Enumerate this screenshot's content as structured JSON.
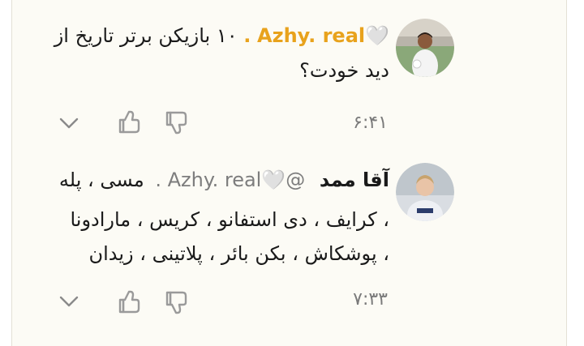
{
  "comments": [
    {
      "username": "Azhy. real",
      "heart": "🤍",
      "separator": ".",
      "text_line1": "۱۰ بازیکن برتر تاریخ از",
      "text_line2": "دید خودت؟",
      "time": "۶:۴۱",
      "icons": [
        "avatar-photo",
        "chevron-down-icon",
        "thumbs-up-icon",
        "thumbs-down-icon"
      ]
    },
    {
      "author": "آقا ممد",
      "mention_at": "@",
      "mention_user": "Azhy. real",
      "heart": "🤍",
      "separator": ".",
      "text_line1_tail": "مسی ، پله",
      "text_line2": "، کرایف ، دی استفانو ، کریس ، مارادونا",
      "text_line3": "، پوشکاش ، بکن بائر ، پلاتینی ، زیدان",
      "time": "۷:۳۳",
      "icons": [
        "avatar-photo",
        "chevron-down-icon",
        "thumbs-up-icon",
        "thumbs-down-icon"
      ]
    }
  ],
  "colors": {
    "username_accent": "#e8a21c",
    "text": "#1a1a1a",
    "muted": "#7a7a7a",
    "icon_stroke": "#9a9a9a",
    "background": "#fcfbf5"
  }
}
